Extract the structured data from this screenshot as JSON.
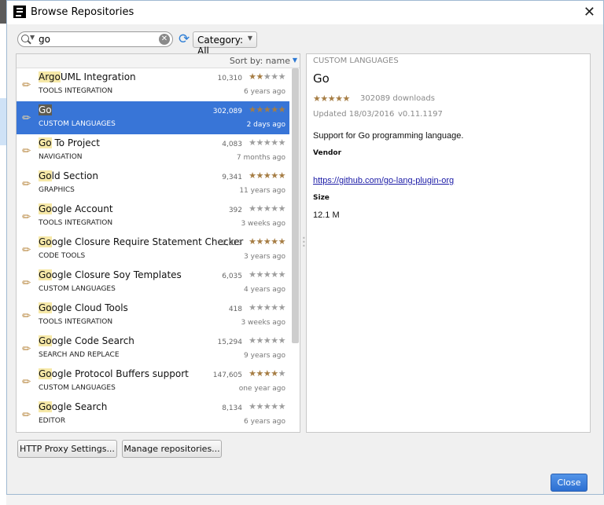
{
  "window": {
    "title": "Browse Repositories",
    "close_glyph": "✕"
  },
  "search": {
    "query": "go"
  },
  "category": {
    "label": "Category: All"
  },
  "list": {
    "sort_label": "Sort by: name",
    "items": [
      {
        "name_hl": "Argo",
        "name_rest": "UML Integration",
        "pre": "",
        "category": "TOOLS INTEGRATION",
        "downloads": "10,310",
        "rating": 1.5,
        "date": "6 years ago"
      },
      {
        "name_hl": "Go",
        "name_rest": "",
        "pre": "",
        "category": "CUSTOM LANGUAGES",
        "downloads": "302,089",
        "rating": 4.5,
        "date": "2 days ago",
        "selected": true
      },
      {
        "name_hl": "Go",
        "name_rest": " To Project",
        "pre": "",
        "category": "NAVIGATION",
        "downloads": "4,083",
        "rating": 0,
        "date": "7 months ago"
      },
      {
        "name_hl": "Go",
        "name_rest": "ld Section",
        "pre": "",
        "category": "GRAPHICS",
        "downloads": "9,341",
        "rating": 5,
        "date": "11 years ago"
      },
      {
        "name_hl": "Go",
        "name_rest": "ogle Account",
        "pre": "",
        "category": "TOOLS INTEGRATION",
        "downloads": "392",
        "rating": 0,
        "date": "3 weeks ago"
      },
      {
        "name_hl": "Go",
        "name_rest": "ogle Closure Require Statement Checker",
        "pre": "",
        "category": "CODE TOOLS",
        "downloads": "2,913",
        "rating": 5,
        "date": "3 years ago"
      },
      {
        "name_hl": "Go",
        "name_rest": "ogle Closure Soy Templates",
        "pre": "",
        "category": "CUSTOM LANGUAGES",
        "downloads": "6,035",
        "rating": 0,
        "date": "4 years ago"
      },
      {
        "name_hl": "Go",
        "name_rest": "ogle Cloud Tools",
        "pre": "",
        "category": "TOOLS INTEGRATION",
        "downloads": "418",
        "rating": 0,
        "date": "3 weeks ago"
      },
      {
        "name_hl": "Go",
        "name_rest": "ogle Code Search",
        "pre": "",
        "category": "SEARCH AND REPLACE",
        "downloads": "15,294",
        "rating": 0,
        "date": "9 years ago"
      },
      {
        "name_hl": "Go",
        "name_rest": "ogle Protocol Buffers support",
        "pre": "",
        "category": "CUSTOM LANGUAGES",
        "downloads": "147,605",
        "rating": 4,
        "date": "one year ago"
      },
      {
        "name_hl": "Go",
        "name_rest": "ogle Search",
        "pre": "",
        "category": "EDITOR",
        "downloads": "8,134",
        "rating": 0,
        "date": "6 years ago"
      }
    ]
  },
  "detail": {
    "category": "CUSTOM LANGUAGES",
    "name": "Go",
    "rating": 4.5,
    "downloads": "302089 downloads",
    "updated": "Updated 18/03/2016",
    "version": "v0.11.1197",
    "description": "Support for Go programming language.",
    "vendor_label": "Vendor",
    "link": "https://github.com/go-lang-plugin-org",
    "size_label": "Size",
    "size": "12.1 M"
  },
  "buttons": {
    "http_proxy": "HTTP Proxy Settings...",
    "manage_repos": "Manage repositories...",
    "close": "Close"
  },
  "colors": {
    "accent": "#3875d7",
    "star": "#a67d44",
    "highlight": "#f6e8a7"
  }
}
